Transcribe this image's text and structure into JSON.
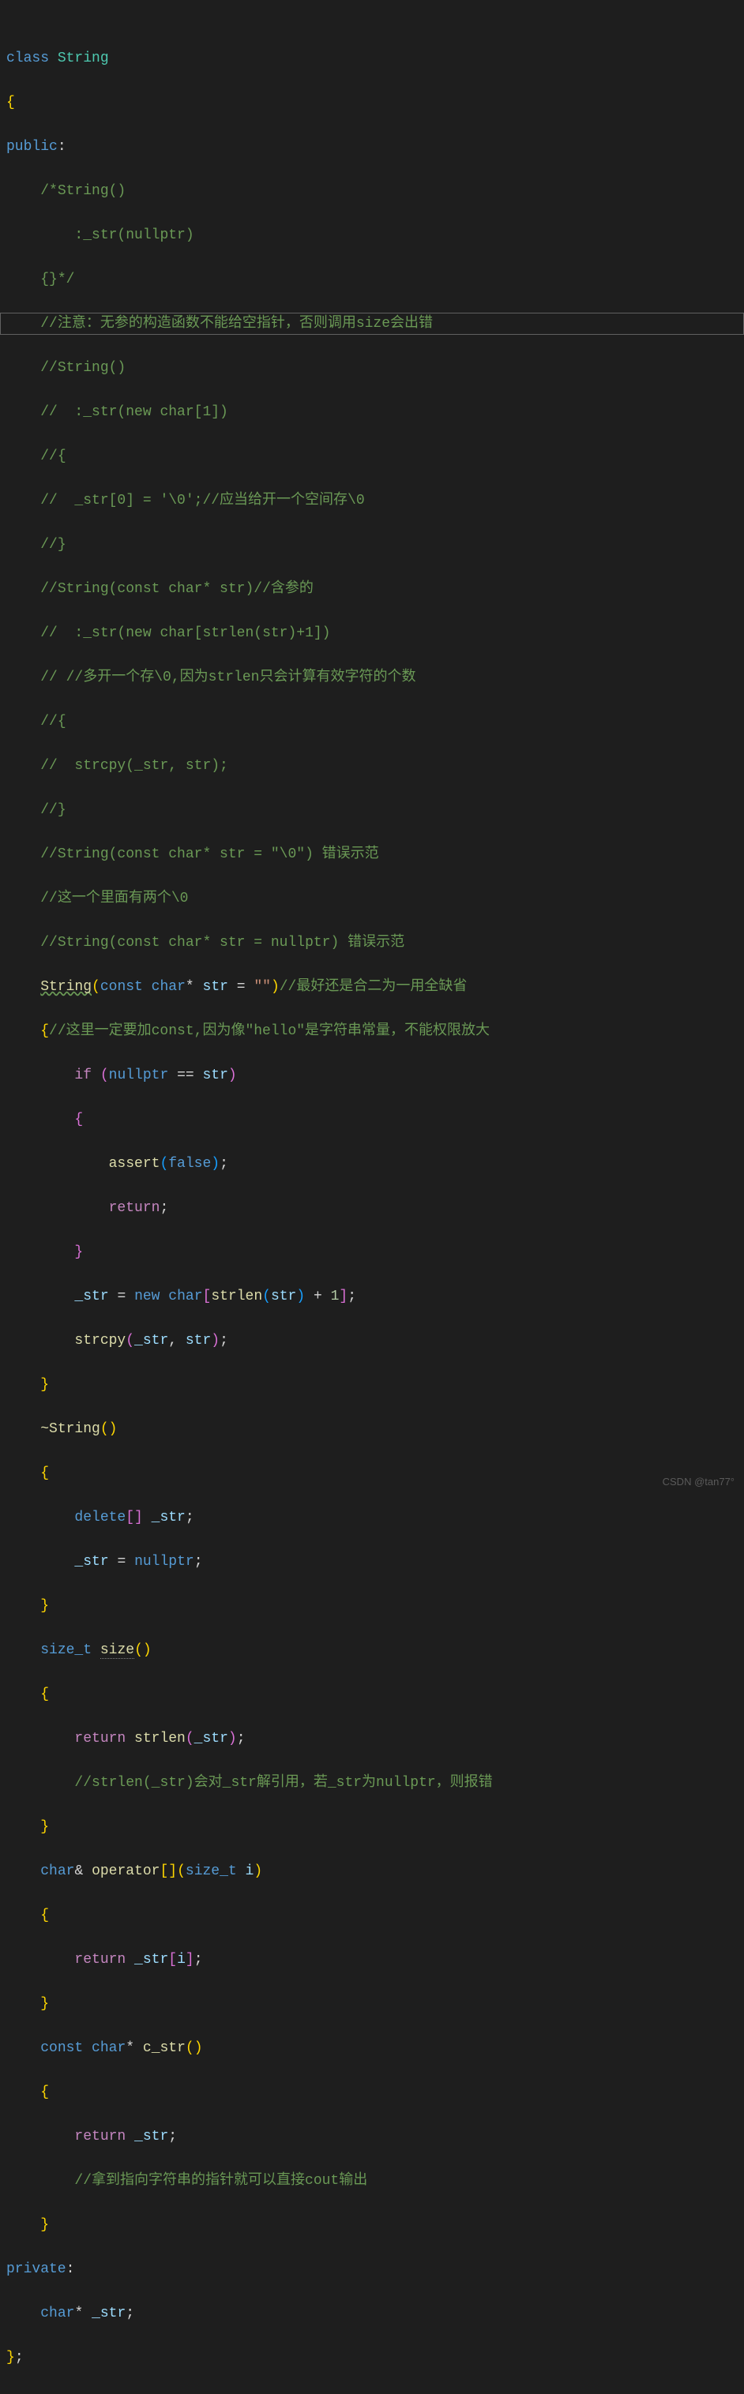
{
  "line1_class": "class",
  "line1_name": "String",
  "line2": "{",
  "line3_public": "public",
  "line3_colon": ":",
  "c1": "/*String()",
  "c2": "    :_str(nullptr)",
  "c3": "{}*/",
  "c4": "//注意：无参的构造函数不能给空指针，否则调用size会出错",
  "c5": "//String()",
  "c6": "//  :_str(new char[1])",
  "c7": "//{",
  "c8": "//  _str[0] = '\\0';//应当给开一个空间存\\0",
  "c9": "//}",
  "c10": "//String(const char* str)//含参的",
  "c11": "//  :_str(new char[strlen(str)+1])",
  "c12": "// //多开一个存\\0,因为strlen只会计算有效字符的个数",
  "c13": "//{",
  "c14": "//  strcpy(_str, str);",
  "c15": "//}",
  "c16": "//String(const char* str = \"\\0\") 错误示范",
  "c17": "//这一个里面有两个\\0",
  "c18": "//String(const char* str = nullptr) 错误示范",
  "ctor_name": "String",
  "ctor_const": "const",
  "ctor_char": "char",
  "ctor_star": "*",
  "ctor_param": "str",
  "ctor_eq": " = ",
  "ctor_default": "\"\"",
  "ctor_cmt": "//最好还是合二为一用全缺省",
  "ctor_brace_cmt": "//这里一定要加const,因为像\"hello\"是字符串常量，不能权限放大",
  "if_kw": "if",
  "nullptr_kw": "nullptr",
  "eqeq": " == ",
  "str_var": "str",
  "assert_fn": "assert",
  "false_kw": "false",
  "return_kw": "return",
  "lbr": "{",
  "rbr": "}",
  "semi": ";",
  "_str_var": "_str",
  "new_kw": "new",
  "char_kw": "char",
  "strlen_fn": "strlen",
  "plus1": " + ",
  "one": "1",
  "strcpy_fn": "strcpy",
  "dtor_name": "~String",
  "delete_kw": "delete",
  "brackets": "[]",
  "size_t_kw": "size_t",
  "size_fn": "size",
  "size_cmt": "//strlen(_str)会对_str解引用，若_str为nullptr，则报错",
  "amp": "&",
  "operator_kw": "operator",
  "i_param": "i",
  "const_kw": "const",
  "c_str_fn": "c_str",
  "c_str_cmt": "//拿到指向字符串的指针就可以直接cout输出",
  "private_kw": "private",
  "watermark": "CSDN @tan77°"
}
